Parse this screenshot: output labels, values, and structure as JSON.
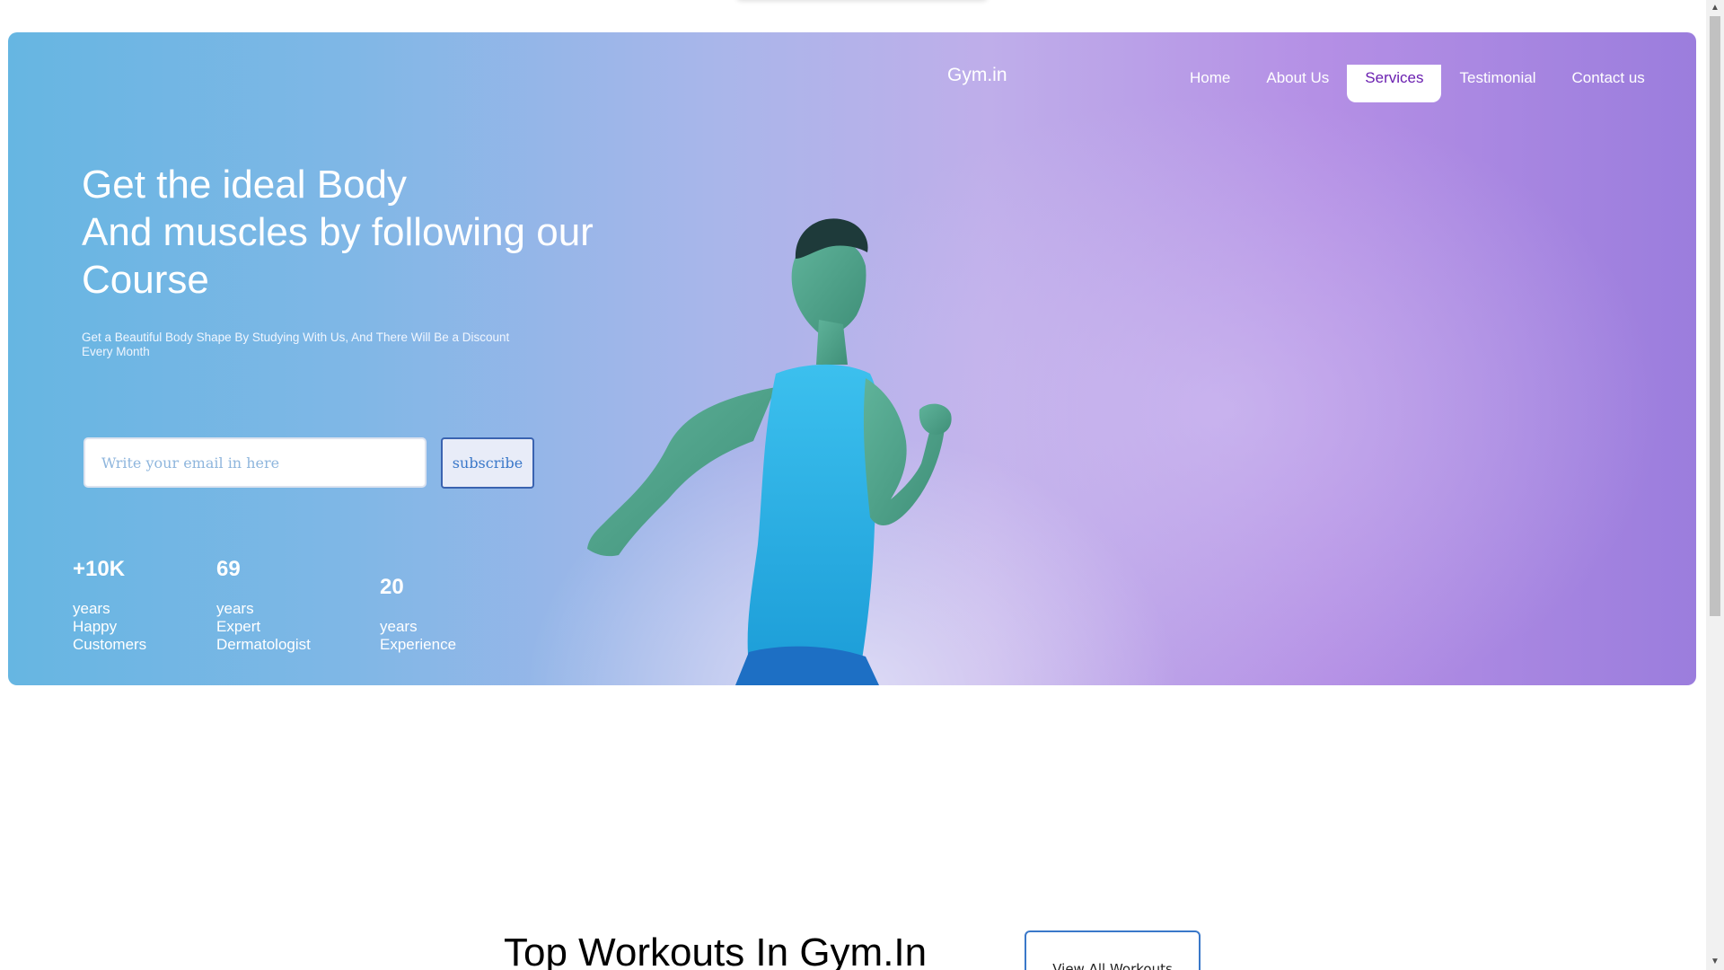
{
  "nav": {
    "logo": "Gym.in",
    "items": [
      {
        "label": "Home"
      },
      {
        "label": "About Us"
      },
      {
        "label": "Services",
        "active": true
      },
      {
        "label": "Testimonial"
      },
      {
        "label": "Contact us"
      }
    ]
  },
  "hero": {
    "headline_line1": "Get the ideal Body",
    "headline_line2": "And muscles by following our",
    "headline_line3": "Course",
    "subtext_line1": "Get a Beautiful Body Shape By Studying With Us, And There Will Be a Discount",
    "subtext_line2": "Every Month",
    "email_placeholder": "Write your email in here",
    "subscribe_label": "subscribe",
    "stats": [
      {
        "value": "+10K",
        "label": "years\nHappy\nCustomers"
      },
      {
        "value": "69",
        "label": "years\nExpert\nDermatologist"
      },
      {
        "value": "20",
        "label": "years\nExperience"
      }
    ]
  },
  "workouts": {
    "title": "Top Workouts In Gym.In",
    "view_all_label": "View All Workouts"
  },
  "colors": {
    "active_nav_text": "#6a1fb0",
    "button_border": "#3a78c9"
  },
  "icons": {
    "scroll_up": "scroll-up-icon",
    "scroll_down": "scroll-down-icon"
  }
}
